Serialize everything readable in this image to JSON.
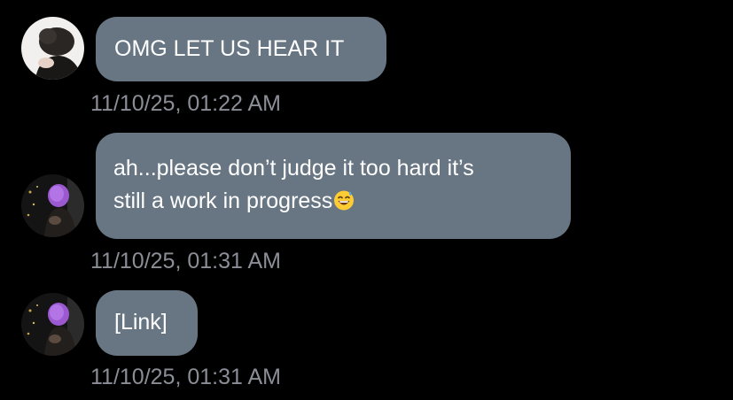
{
  "messages": [
    {
      "text": "OMG LET US HEAR IT",
      "timestamp": "11/10/25, 01:22 AM",
      "avatar": "avatar-user-dark-hair"
    },
    {
      "line1": "ah...please don’t judge it too hard it’s",
      "line2": "still a work in progress",
      "emoji": "grinning-sweat-emoji",
      "timestamp": "11/10/25, 01:31 AM",
      "avatar": "avatar-user-purple-hair"
    },
    {
      "text": "[Link]",
      "timestamp": "11/10/25, 01:31 AM",
      "avatar": "avatar-user-purple-hair"
    }
  ],
  "colors": {
    "background": "#000000",
    "bubble": "#687683",
    "bubble_text": "#ffffff",
    "timestamp": "#8b8e96"
  }
}
